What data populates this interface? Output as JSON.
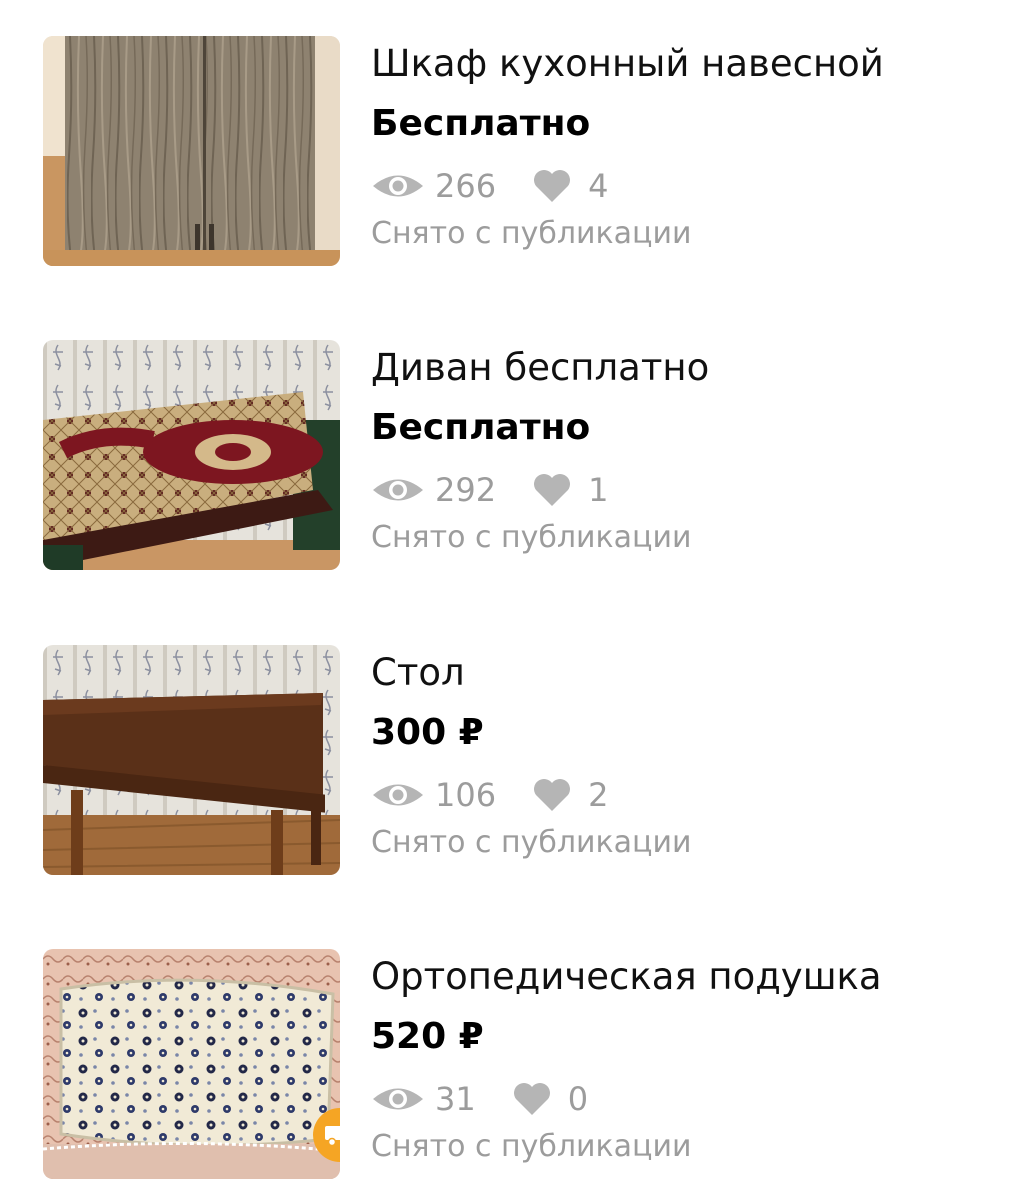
{
  "listings": [
    {
      "title": "Шкаф кухонный навесной",
      "price": "Бесплатно",
      "views": "266",
      "likes": "4",
      "status": "Снято с публикации",
      "thumbnail": "kitchen-cabinet-photo"
    },
    {
      "title": "Диван бесплатно",
      "price": "Бесплатно",
      "views": "292",
      "likes": "1",
      "status": "Снято с публикации",
      "thumbnail": "sofa-photo"
    },
    {
      "title": "Стол",
      "price": "300 ₽",
      "views": "106",
      "likes": "2",
      "status": "Снято с публикации",
      "thumbnail": "table-photo"
    },
    {
      "title": "Ортопедическая подушка",
      "price": "520 ₽",
      "views": "31",
      "likes": "0",
      "status": "Снято с публикации",
      "thumbnail": "pillow-photo",
      "badge": "delivery-truck-icon"
    }
  ],
  "colors": {
    "meta_text": "#9c9c9c",
    "delivery_badge": "#f5a524"
  }
}
